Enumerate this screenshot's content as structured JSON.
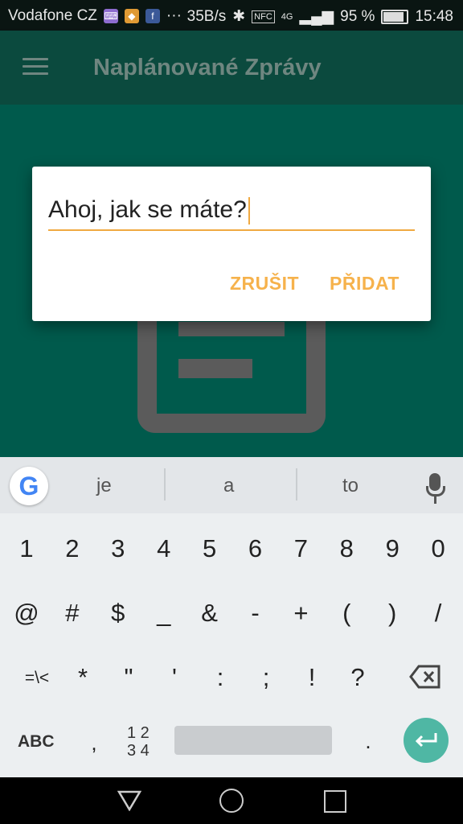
{
  "status_bar": {
    "carrier": "Vodafone CZ",
    "notification_icons": [
      "keyboard-icon",
      "ticket-icon",
      "facebook-icon"
    ],
    "more": "···",
    "speed": "35B/s",
    "network": "4G",
    "battery": "95 %",
    "battery_level": 0.95,
    "time": "15:48"
  },
  "app_bar": {
    "menu_icon": "hamburger-icon",
    "title": "Naplánované Zprávy"
  },
  "dialog": {
    "input_value": "Ahoj, jak se máte?",
    "cancel_label": "ZRUŠIT",
    "add_label": "PŘIDAT",
    "accent": "#f6b24c"
  },
  "keyboard": {
    "google_logo": "G",
    "suggestions": [
      "je",
      "a",
      "to"
    ],
    "row1": [
      "1",
      "2",
      "3",
      "4",
      "5",
      "6",
      "7",
      "8",
      "9",
      "0"
    ],
    "row2": [
      "@",
      "#",
      "$",
      "_",
      "&",
      "-",
      "+",
      "(",
      ")",
      "/"
    ],
    "row3": [
      "=\\<",
      "*",
      "\"",
      "'",
      ":",
      ";",
      "!",
      "?"
    ],
    "abc_label": "ABC",
    "comma": ",",
    "numpad_top": "1 2",
    "numpad_bottom": "3 4",
    "period": "."
  },
  "colors": {
    "primary": "#005a4c",
    "app_bar": "#0b4a3e",
    "enter_key": "#4fb7a4"
  }
}
